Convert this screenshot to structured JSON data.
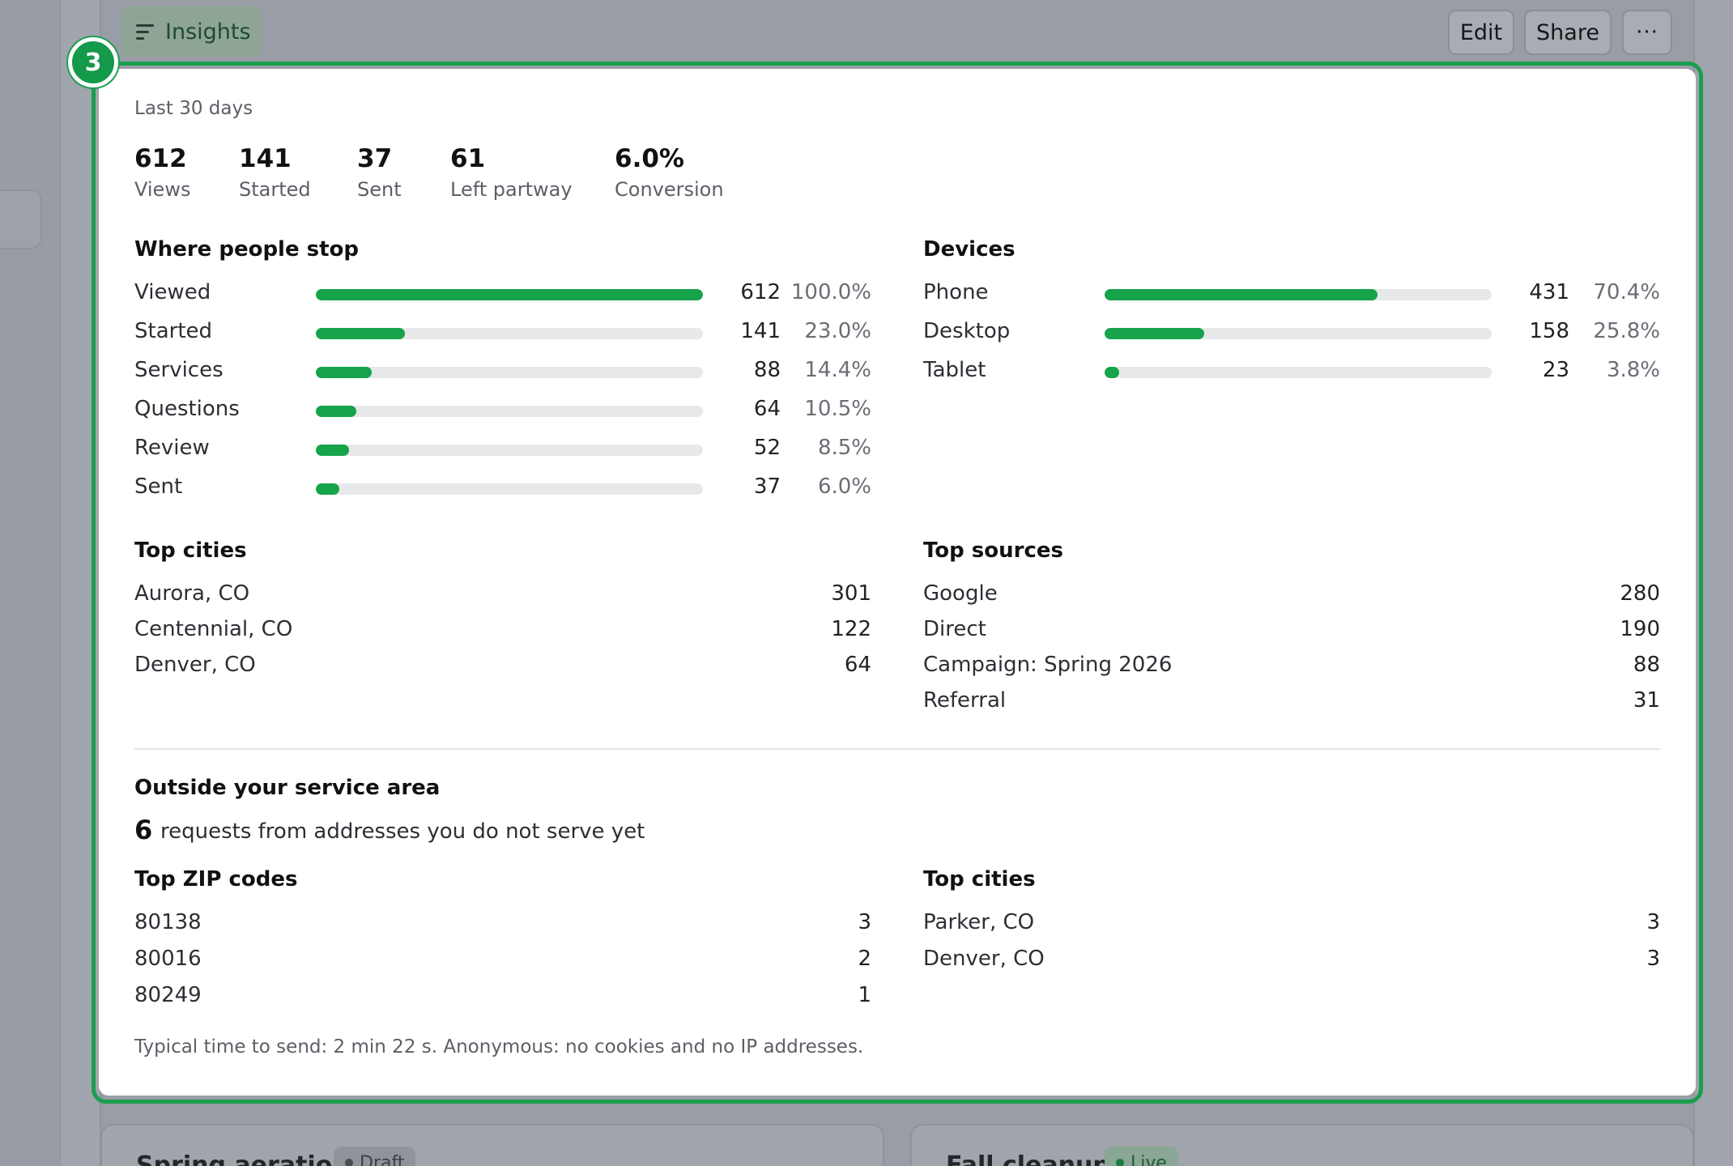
{
  "header": {
    "tab_label": "Insights",
    "edit_label": "Edit",
    "share_label": "Share",
    "more_label": "···"
  },
  "step_badge": "3",
  "period": "Last 30 days",
  "kpis": [
    {
      "value": "612",
      "label": "Views"
    },
    {
      "value": "141",
      "label": "Started"
    },
    {
      "value": "37",
      "label": "Sent"
    },
    {
      "value": "61",
      "label": "Left partway"
    },
    {
      "value": "6.0%",
      "label": "Conversion"
    }
  ],
  "funnel": {
    "title": "Where people stop",
    "rows": [
      {
        "label": "Viewed",
        "count": "612",
        "pct": "100.0%",
        "fraction": 1.0
      },
      {
        "label": "Started",
        "count": "141",
        "pct": "23.0%",
        "fraction": 0.23
      },
      {
        "label": "Services",
        "count": "88",
        "pct": "14.4%",
        "fraction": 0.144
      },
      {
        "label": "Questions",
        "count": "64",
        "pct": "10.5%",
        "fraction": 0.105
      },
      {
        "label": "Review",
        "count": "52",
        "pct": "8.5%",
        "fraction": 0.085
      },
      {
        "label": "Sent",
        "count": "37",
        "pct": "6.0%",
        "fraction": 0.06
      }
    ]
  },
  "devices": {
    "title": "Devices",
    "rows": [
      {
        "label": "Phone",
        "count": "431",
        "pct": "70.4%",
        "fraction": 0.704
      },
      {
        "label": "Desktop",
        "count": "158",
        "pct": "25.8%",
        "fraction": 0.258
      },
      {
        "label": "Tablet",
        "count": "23",
        "pct": "3.8%",
        "fraction": 0.038
      }
    ]
  },
  "top_cities": {
    "title": "Top cities",
    "rows": [
      {
        "label": "Aurora, CO",
        "count": "301"
      },
      {
        "label": "Centennial, CO",
        "count": "122"
      },
      {
        "label": "Denver, CO",
        "count": "64"
      }
    ]
  },
  "top_sources": {
    "title": "Top sources",
    "rows": [
      {
        "label": "Google",
        "count": "280"
      },
      {
        "label": "Direct",
        "count": "190"
      },
      {
        "label": "Campaign: Spring 2026",
        "count": "88"
      },
      {
        "label": "Referral",
        "count": "31"
      }
    ]
  },
  "outside": {
    "title": "Outside your service area",
    "count": "6",
    "text": "requests from addresses you do not serve yet",
    "zip_title": "Top ZIP codes",
    "zips": [
      {
        "label": "80138",
        "count": "3"
      },
      {
        "label": "80016",
        "count": "2"
      },
      {
        "label": "80249",
        "count": "1"
      }
    ],
    "cities_title": "Top cities",
    "cities": [
      {
        "label": "Parker, CO",
        "count": "3"
      },
      {
        "label": "Denver, CO",
        "count": "3"
      }
    ]
  },
  "footer_note": "Typical time to send: 2 min 22 s. Anonymous: no cookies and no IP addresses.",
  "peek_cards": [
    {
      "title": "Spring aeration",
      "badge": "Draft"
    },
    {
      "title": "Fall cleanup",
      "badge": "Live"
    }
  ],
  "colors": {
    "accent": "#16a34a",
    "highlight": "#1a9e4e",
    "track": "#e7e8ea"
  }
}
